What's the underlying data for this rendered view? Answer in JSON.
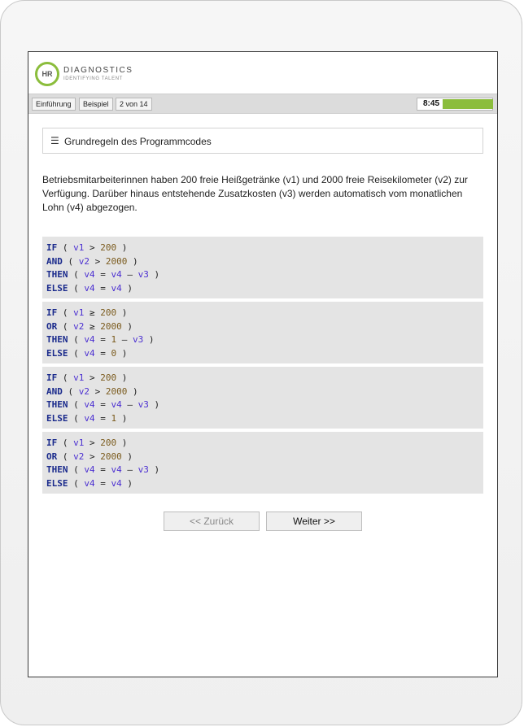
{
  "header": {
    "logo_initials": "HR",
    "logo_name": "DIAGNOSTICS",
    "logo_tagline": "IDENTIFYING TALENT"
  },
  "nav": {
    "intro_label": "Einführung",
    "example_label": "Beispiel",
    "page_counter": "2 von 14",
    "timer": "8:45",
    "timer_progress_percent": 100
  },
  "panel": {
    "menu_icon": "☰",
    "title": "Grundregeln des Programmcodes"
  },
  "description": "Betriebsmitarbeiterinnen haben 200 freie Heißgetränke (v1) und 2000 freie Reisekilometer (v2) zur Verfügung. Darüber hinaus entstehende Zusatzkosten (v3) werden automatisch vom monatlichen Lohn (v4) abgezogen.",
  "options": [
    {
      "lines": [
        [
          {
            "t": "kw",
            "v": "IF"
          },
          {
            "t": "op",
            "v": " ( "
          },
          {
            "t": "var",
            "v": "v1"
          },
          {
            "t": "op",
            "v": " > "
          },
          {
            "t": "num",
            "v": "200"
          },
          {
            "t": "op",
            "v": " )"
          }
        ],
        [
          {
            "t": "kw",
            "v": "AND"
          },
          {
            "t": "op",
            "v": " ( "
          },
          {
            "t": "var",
            "v": "v2"
          },
          {
            "t": "op",
            "v": " > "
          },
          {
            "t": "num",
            "v": "2000"
          },
          {
            "t": "op",
            "v": " )"
          }
        ],
        [
          {
            "t": "kw",
            "v": "THEN"
          },
          {
            "t": "op",
            "v": " ( "
          },
          {
            "t": "var",
            "v": "v4"
          },
          {
            "t": "op",
            "v": " = "
          },
          {
            "t": "var",
            "v": "v4"
          },
          {
            "t": "op",
            "v": " – "
          },
          {
            "t": "var",
            "v": "v3"
          },
          {
            "t": "op",
            "v": " )"
          }
        ],
        [
          {
            "t": "kw",
            "v": "ELSE"
          },
          {
            "t": "op",
            "v": " ( "
          },
          {
            "t": "var",
            "v": "v4"
          },
          {
            "t": "op",
            "v": " = "
          },
          {
            "t": "var",
            "v": "v4"
          },
          {
            "t": "op",
            "v": " )"
          }
        ]
      ]
    },
    {
      "lines": [
        [
          {
            "t": "kw",
            "v": "IF"
          },
          {
            "t": "op",
            "v": " ( "
          },
          {
            "t": "var",
            "v": "v1"
          },
          {
            "t": "op",
            "v": " ≥ "
          },
          {
            "t": "num",
            "v": "200"
          },
          {
            "t": "op",
            "v": " )"
          }
        ],
        [
          {
            "t": "kw",
            "v": "OR"
          },
          {
            "t": "op",
            "v": " ( "
          },
          {
            "t": "var",
            "v": "v2"
          },
          {
            "t": "op",
            "v": " ≥ "
          },
          {
            "t": "num",
            "v": "2000"
          },
          {
            "t": "op",
            "v": " )"
          }
        ],
        [
          {
            "t": "kw",
            "v": "THEN"
          },
          {
            "t": "op",
            "v": " ( "
          },
          {
            "t": "var",
            "v": "v4"
          },
          {
            "t": "op",
            "v": " = "
          },
          {
            "t": "num",
            "v": "1"
          },
          {
            "t": "op",
            "v": " – "
          },
          {
            "t": "var",
            "v": "v3"
          },
          {
            "t": "op",
            "v": " )"
          }
        ],
        [
          {
            "t": "kw",
            "v": "ELSE"
          },
          {
            "t": "op",
            "v": " ( "
          },
          {
            "t": "var",
            "v": "v4"
          },
          {
            "t": "op",
            "v": " = "
          },
          {
            "t": "num",
            "v": "0"
          },
          {
            "t": "op",
            "v": " )"
          }
        ]
      ]
    },
    {
      "lines": [
        [
          {
            "t": "kw",
            "v": "IF"
          },
          {
            "t": "op",
            "v": " ( "
          },
          {
            "t": "var",
            "v": "v1"
          },
          {
            "t": "op",
            "v": " > "
          },
          {
            "t": "num",
            "v": "200"
          },
          {
            "t": "op",
            "v": " )"
          }
        ],
        [
          {
            "t": "kw",
            "v": "AND"
          },
          {
            "t": "op",
            "v": " ( "
          },
          {
            "t": "var",
            "v": "v2"
          },
          {
            "t": "op",
            "v": " > "
          },
          {
            "t": "num",
            "v": "2000"
          },
          {
            "t": "op",
            "v": " )"
          }
        ],
        [
          {
            "t": "kw",
            "v": "THEN"
          },
          {
            "t": "op",
            "v": " ( "
          },
          {
            "t": "var",
            "v": "v4"
          },
          {
            "t": "op",
            "v": " = "
          },
          {
            "t": "var",
            "v": "v4"
          },
          {
            "t": "op",
            "v": " – "
          },
          {
            "t": "var",
            "v": "v3"
          },
          {
            "t": "op",
            "v": " )"
          }
        ],
        [
          {
            "t": "kw",
            "v": "ELSE"
          },
          {
            "t": "op",
            "v": " ( "
          },
          {
            "t": "var",
            "v": "v4"
          },
          {
            "t": "op",
            "v": " = "
          },
          {
            "t": "num",
            "v": "1"
          },
          {
            "t": "op",
            "v": " )"
          }
        ]
      ]
    },
    {
      "lines": [
        [
          {
            "t": "kw",
            "v": "IF"
          },
          {
            "t": "op",
            "v": " ( "
          },
          {
            "t": "var",
            "v": "v1"
          },
          {
            "t": "op",
            "v": " > "
          },
          {
            "t": "num",
            "v": "200"
          },
          {
            "t": "op",
            "v": " )"
          }
        ],
        [
          {
            "t": "kw",
            "v": "OR"
          },
          {
            "t": "op",
            "v": " ( "
          },
          {
            "t": "var",
            "v": "v2"
          },
          {
            "t": "op",
            "v": " > "
          },
          {
            "t": "num",
            "v": "2000"
          },
          {
            "t": "op",
            "v": " )"
          }
        ],
        [
          {
            "t": "kw",
            "v": "THEN"
          },
          {
            "t": "op",
            "v": " ( "
          },
          {
            "t": "var",
            "v": "v4"
          },
          {
            "t": "op",
            "v": " = "
          },
          {
            "t": "var",
            "v": "v4"
          },
          {
            "t": "op",
            "v": " – "
          },
          {
            "t": "var",
            "v": "v3"
          },
          {
            "t": "op",
            "v": " )"
          }
        ],
        [
          {
            "t": "kw",
            "v": "ELSE"
          },
          {
            "t": "op",
            "v": " ( "
          },
          {
            "t": "var",
            "v": "v4"
          },
          {
            "t": "op",
            "v": " = "
          },
          {
            "t": "var",
            "v": "v4"
          },
          {
            "t": "op",
            "v": " )"
          }
        ]
      ]
    }
  ],
  "buttons": {
    "back_label": "<< Zurück",
    "next_label": "Weiter >>"
  },
  "colors": {
    "accent": "#8bbd3c",
    "keyword": "#1a2a8c",
    "variable": "#4b2fd1",
    "number": "#7a5a1c",
    "option_bg": "#e4e4e4"
  }
}
